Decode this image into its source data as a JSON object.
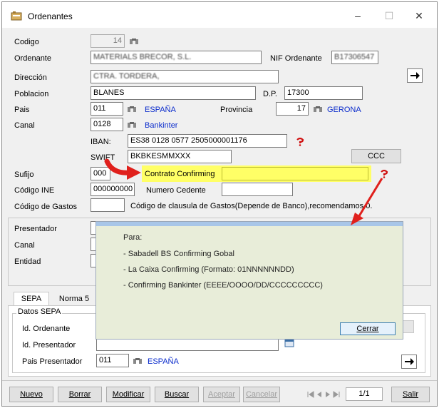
{
  "window": {
    "title": "Ordenantes",
    "minimize": "–",
    "maximize": "☐",
    "close": "✕"
  },
  "form": {
    "codigo": {
      "label": "Codigo",
      "value": "14"
    },
    "ordenante": {
      "label": "Ordenante",
      "value": "MATERIALS BRECOR, S.L."
    },
    "nif": {
      "label": "NIF Ordenante",
      "value": "B17306547"
    },
    "direccion": {
      "label": "Dirección",
      "value": "CTRA. TORDERA,"
    },
    "poblacion": {
      "label": "Poblacion",
      "value": "BLANES"
    },
    "dp": {
      "label": "D.P.",
      "value": "17300"
    },
    "pais": {
      "label": "Pais",
      "code": "011",
      "name": "ESPAÑA"
    },
    "provincia": {
      "label": "Provincia",
      "code": "17",
      "name": "GERONA"
    },
    "canal": {
      "label": "Canal",
      "code": "0128",
      "name": "Bankinter"
    },
    "iban": {
      "label": "IBAN:",
      "value": "ES38 0128 0577 2505000001176"
    },
    "swift": {
      "label": "SWIFT",
      "value": "BKBKESMMXXX"
    },
    "ccc_button": "CCC",
    "sufijo": {
      "label": "Sufijo",
      "value": "000"
    },
    "contrato": {
      "label": "Contrato Confirming",
      "value": ""
    },
    "codigo_ine": {
      "label": "Código INE",
      "value": "000000000"
    },
    "numero_cedente": {
      "label": "Numero Cedente",
      "value": ""
    },
    "codigo_gastos": {
      "label": "Código de Gastos",
      "value": "",
      "note": "Código de clausula de Gastos(Depende de Banco),recomendamos 0."
    }
  },
  "lower": {
    "presentador": "Presentador",
    "canal": "Canal",
    "entidad": "Entidad"
  },
  "tabs": [
    {
      "label": "SEPA"
    },
    {
      "label": "Norma 5"
    }
  ],
  "sepa": {
    "group_title": "Datos SEPA",
    "id_ordenante": "Id. Ordenante",
    "id_presentador": "Id. Presentador",
    "pais_presentador": {
      "label": "Pais Presentador",
      "code": "011",
      "name": "ESPAÑA"
    }
  },
  "popup": {
    "heading": "Para:",
    "lines": [
      "- Sabadell BS Confirming Gobal",
      "- La Caixa Confirming (Formato: 01NNNNNNDD)",
      "- Confirming Bankinter (EEEE/OOOO/DD/CCCCCCCCC)"
    ],
    "close_button": "Cerrar"
  },
  "bottom_bar": {
    "nuevo": "Nuevo",
    "borrar": "Borrar",
    "modificar": "Modificar",
    "buscar": "Buscar",
    "aceptar": "Aceptar",
    "cancelar": "Cancelar",
    "record": "1/1",
    "salir": "Salir"
  },
  "annotation_color": "#e0201c",
  "highlight_color": "#ffff66"
}
